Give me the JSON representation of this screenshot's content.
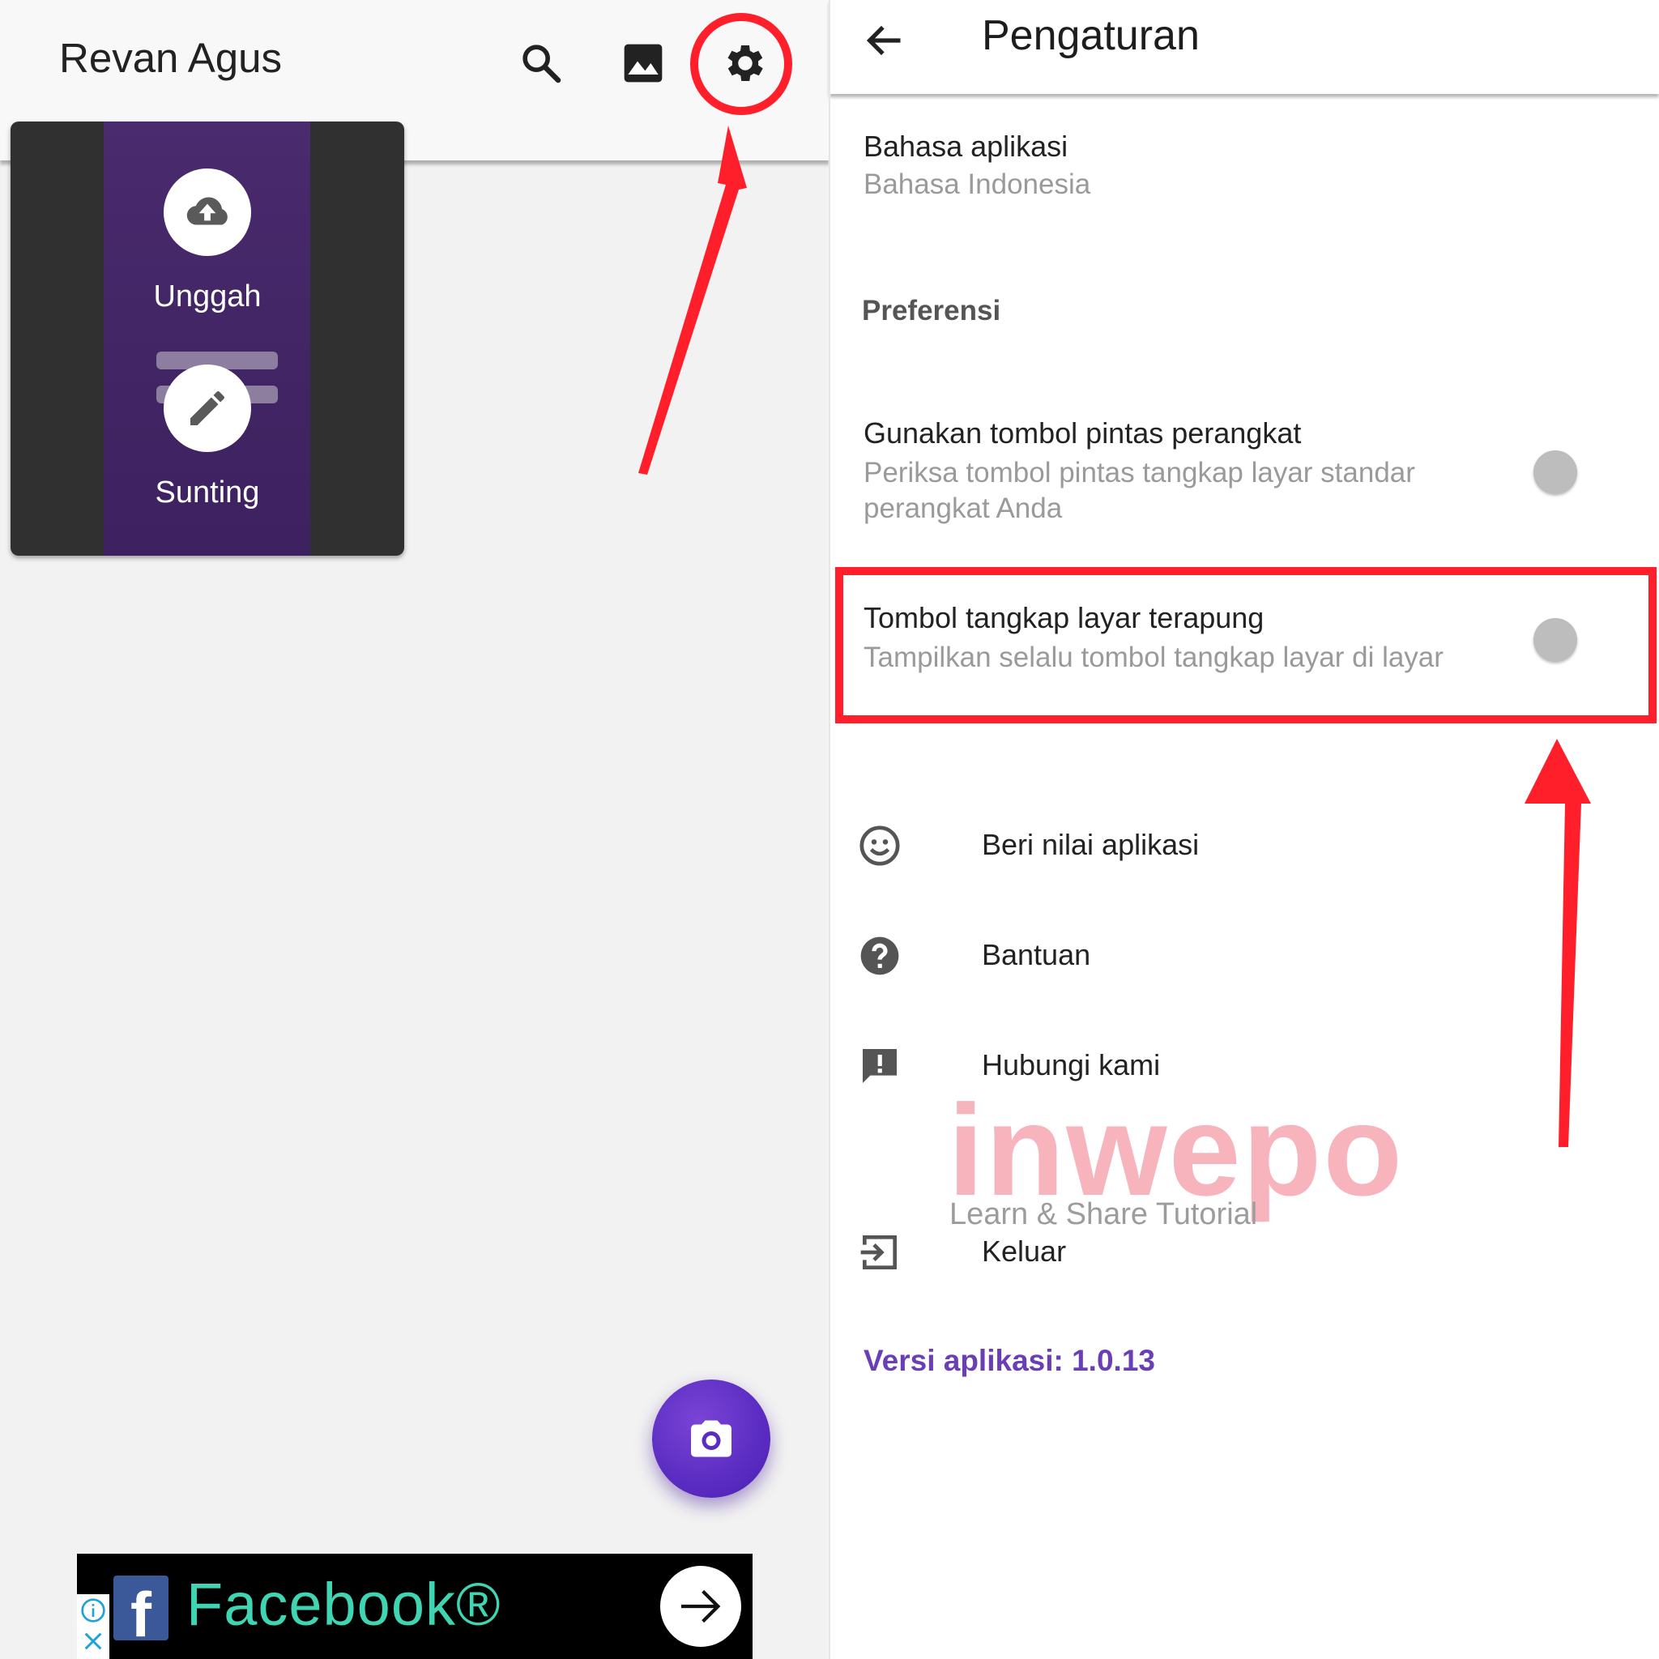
{
  "left": {
    "title": "Revan Agus",
    "thumbnail": {
      "upload_label": "Unggah",
      "edit_label": "Sunting"
    },
    "ad": {
      "brand": "Facebook®",
      "logo_letter": "f"
    }
  },
  "right": {
    "title": "Pengaturan",
    "language": {
      "title": "Bahasa aplikasi",
      "value": "Bahasa Indonesia"
    },
    "section_preferences": "Preferensi",
    "device_shortcut": {
      "title": "Gunakan tombol pintas perangkat",
      "subtitle": "Periksa tombol pintas tangkap layar standar perangkat Anda",
      "enabled": false
    },
    "floating_button": {
      "title": "Tombol tangkap layar terapung",
      "subtitle": "Tampilkan selalu tombol tangkap layar di layar",
      "enabled": false
    },
    "menu": [
      {
        "label": "Beri nilai aplikasi",
        "icon": "smiley-icon"
      },
      {
        "label": "Bantuan",
        "icon": "help-icon"
      },
      {
        "label": "Hubungi kami",
        "icon": "feedback-icon"
      },
      {
        "label": "Keluar",
        "icon": "logout-icon"
      }
    ],
    "version": "Versi aplikasi: 1.0.13"
  },
  "watermark": {
    "word": "inwepo",
    "tagline": "Learn & Share Tutorial"
  },
  "colors": {
    "accent_purple": "#5b2cc2",
    "annotation_red": "#ff1f2a",
    "version_purple": "#6a3fb5"
  }
}
